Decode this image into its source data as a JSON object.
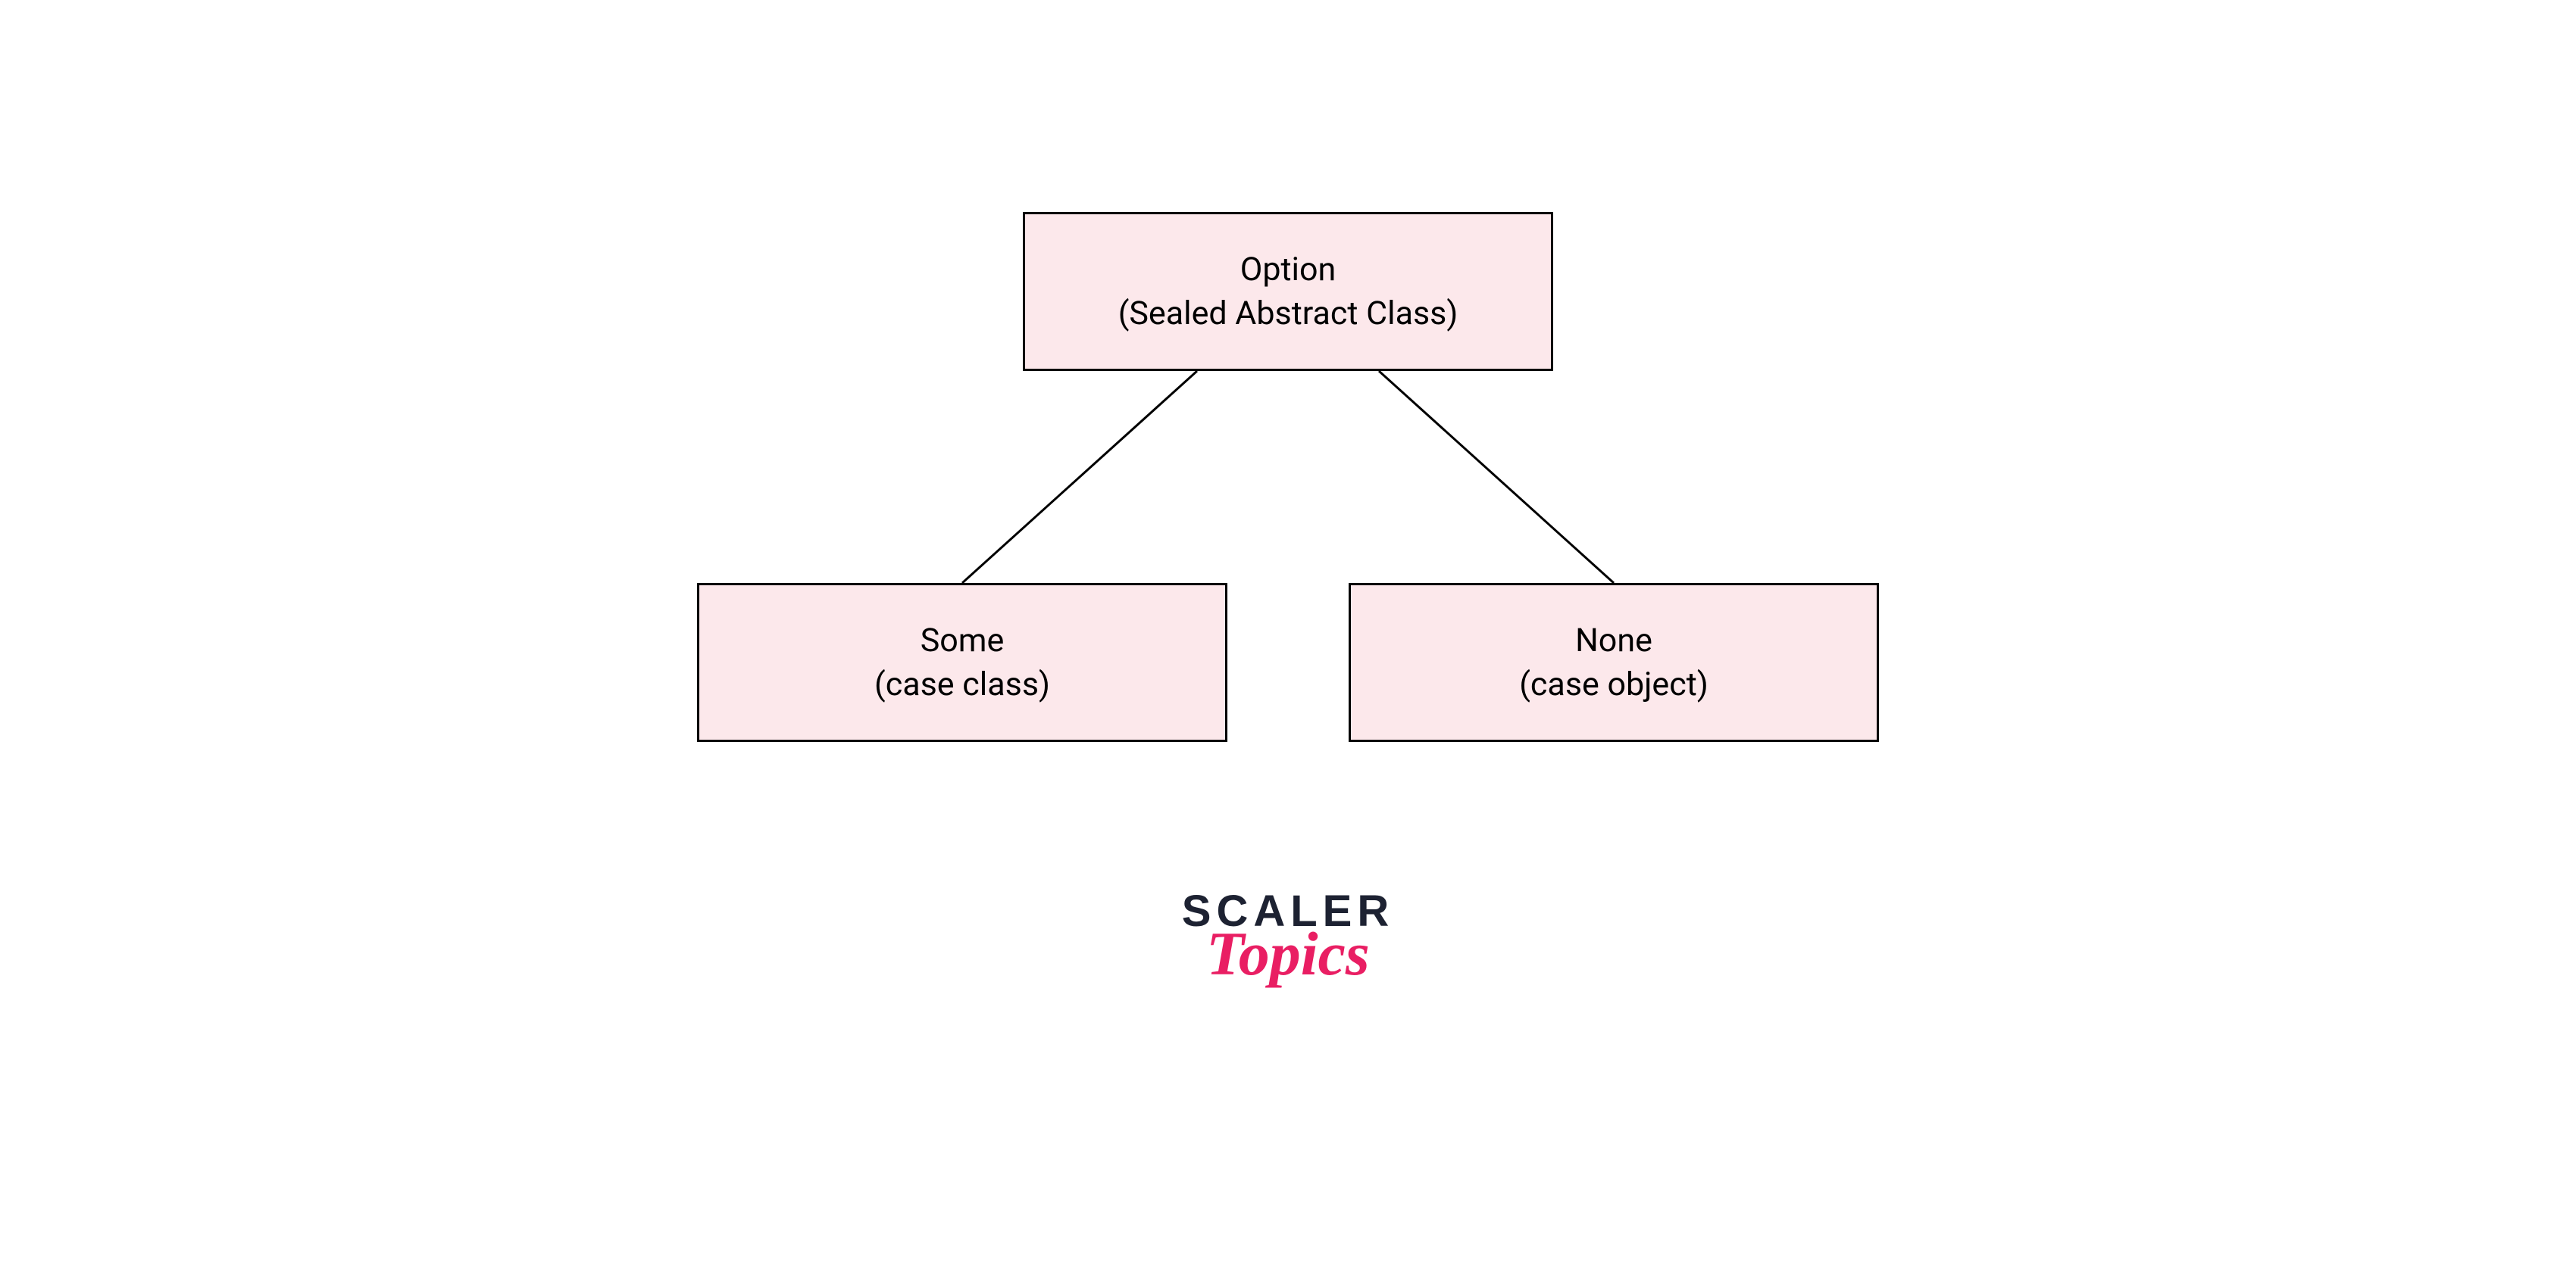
{
  "diagram": {
    "parent": {
      "line1": "Option",
      "line2": "(Sealed Abstract Class)"
    },
    "left_child": {
      "line1": "Some",
      "line2": "(case class)"
    },
    "right_child": {
      "line1": "None",
      "line2": "(case object)"
    }
  },
  "branding": {
    "scaler": "SCALER",
    "topics": "Topics"
  },
  "colors": {
    "node_fill": "#fce8eb",
    "node_border": "#000000",
    "logo_dark": "#1d2232",
    "logo_accent": "#e91e63"
  }
}
